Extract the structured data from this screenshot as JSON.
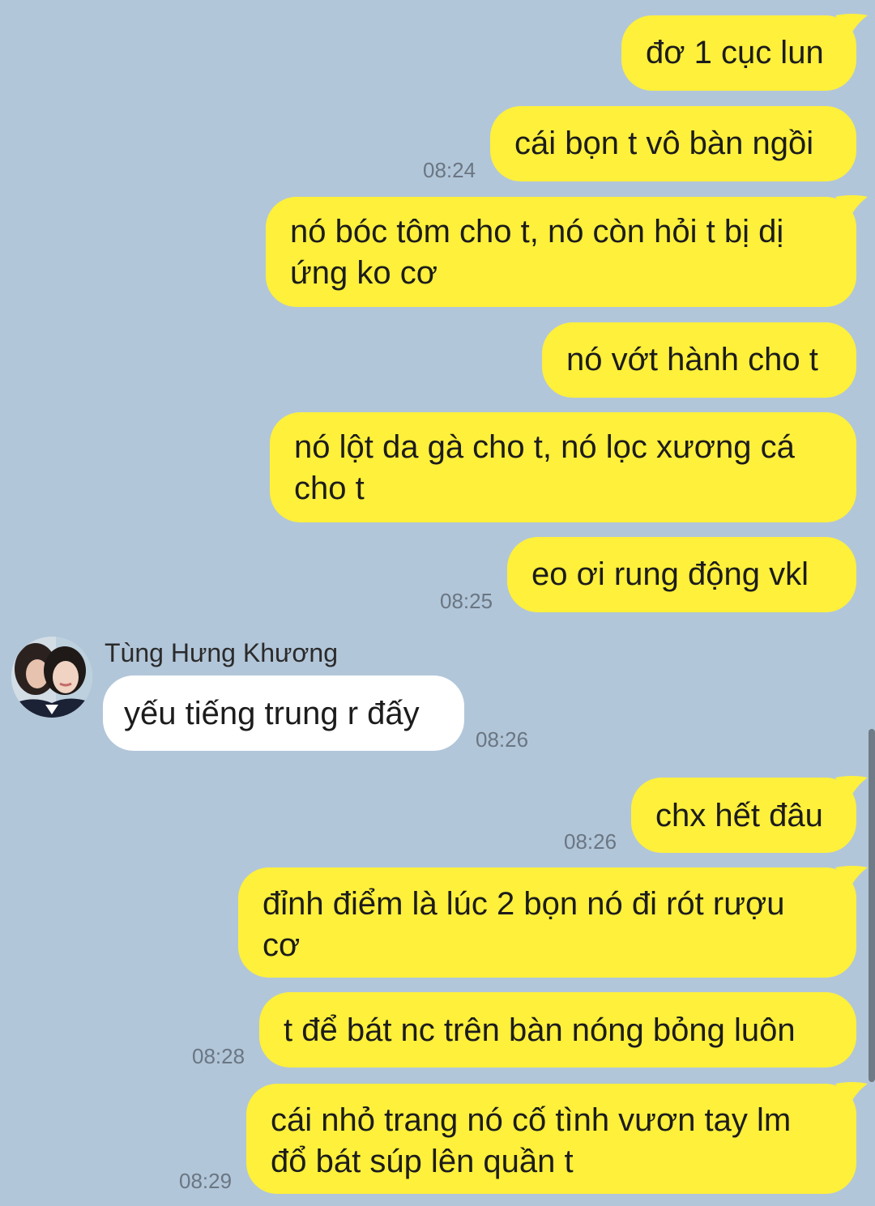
{
  "messages": [
    {
      "text": "đơ 1 cục lun",
      "time": ""
    },
    {
      "text": "cái bọn t vô bàn ngồi",
      "time": "08:24"
    },
    {
      "text": "nó bóc tôm cho t, nó còn hỏi t bị dị ứng ko cơ",
      "time": ""
    },
    {
      "text": "nó vớt hành cho t",
      "time": ""
    },
    {
      "text": "nó lột da gà cho t, nó lọc xương cá cho t",
      "time": ""
    },
    {
      "text": "eo ơi rung động vkl",
      "time": "08:25"
    },
    {
      "sender": "Tùng Hưng Khương",
      "text": "yếu tiếng trung r đấy",
      "time": "08:26"
    },
    {
      "text": "chx hết đâu",
      "time": "08:26"
    },
    {
      "text": "đỉnh điểm là lúc 2 bọn nó đi rót rượu cơ",
      "time": ""
    },
    {
      "text": "t để bát nc trên bàn nóng bỏng luôn",
      "time": "08:28"
    },
    {
      "text": "cái nhỏ trang nó cố tình vươn tay lm đổ bát súp lên quần t",
      "time": "08:29"
    }
  ],
  "colors": {
    "background": "#b2c6d9",
    "outgoing_bubble": "#fef03b",
    "incoming_bubble": "#ffffff",
    "timestamp": "#6a7683"
  },
  "icons": {
    "contact_avatar": "avatar-photo"
  }
}
